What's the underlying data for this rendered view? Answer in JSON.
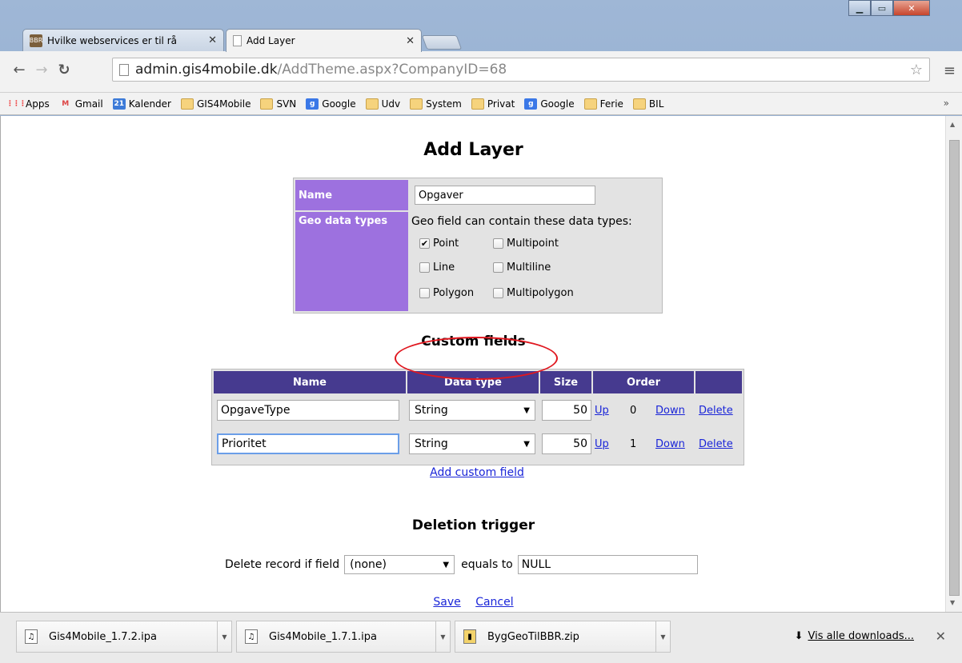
{
  "browser": {
    "tabs": [
      {
        "title": "Hvilke webservices er til rå",
        "favicon": "BBR"
      },
      {
        "title": "Add Layer"
      }
    ],
    "address": {
      "domain": "admin.gis4mobile.dk",
      "path": "/AddTheme.aspx?CompanyID=68"
    },
    "bookmarks": [
      {
        "label": "Apps",
        "icon": "apps-grid-icon"
      },
      {
        "label": "Gmail",
        "icon": "gmail-icon"
      },
      {
        "label": "Kalender",
        "icon": "calendar-icon",
        "icon_text": "21"
      },
      {
        "label": "GIS4Mobile",
        "icon": "folder-icon"
      },
      {
        "label": "SVN",
        "icon": "folder-icon"
      },
      {
        "label": "Google",
        "icon": "google-icon"
      },
      {
        "label": "Udv",
        "icon": "folder-icon"
      },
      {
        "label": "System",
        "icon": "folder-icon"
      },
      {
        "label": "Privat",
        "icon": "folder-icon"
      },
      {
        "label": "Google",
        "icon": "google-icon"
      },
      {
        "label": "Ferie",
        "icon": "folder-icon"
      },
      {
        "label": "BIL",
        "icon": "folder-icon"
      }
    ],
    "more_bookmarks": "»"
  },
  "page": {
    "title": "Add Layer",
    "name_label": "Name",
    "name_value": "Opgaver",
    "geo_label": "Geo data types",
    "geo_help": "Geo field can contain these data types:",
    "geo_types": [
      {
        "label": "Point",
        "checked": true
      },
      {
        "label": "Multipoint",
        "checked": false
      },
      {
        "label": "Line",
        "checked": false
      },
      {
        "label": "Multiline",
        "checked": false
      },
      {
        "label": "Polygon",
        "checked": false
      },
      {
        "label": "Multipolygon",
        "checked": false
      }
    ],
    "custom_fields_title": "Custom fields",
    "columns": [
      "Name",
      "Data type",
      "Size",
      "Order"
    ],
    "rows": [
      {
        "name": "OpgaveType",
        "type": "String",
        "size": "50",
        "up": "Up",
        "order": "0",
        "down": "Down",
        "delete": "Delete"
      },
      {
        "name": "Prioritet",
        "type": "String",
        "size": "50",
        "up": "Up",
        "order": "1",
        "down": "Down",
        "delete": "Delete"
      }
    ],
    "add_custom_field": "Add custom field",
    "deletion_title": "Deletion trigger",
    "delete_prefix": "Delete record if field",
    "delete_field": "(none)",
    "equals_to": "equals to",
    "equals_value": "NULL",
    "save": "Save",
    "cancel": "Cancel"
  },
  "downloads": {
    "items": [
      "Gis4Mobile_1.7.2.ipa",
      "Gis4Mobile_1.7.1.ipa",
      "BygGeoTilBBR.zip"
    ],
    "show_all": "Vis alle downloads..."
  },
  "colors": {
    "label_bg": "#9d71df",
    "header_bg": "#463a8f",
    "link": "#1a25d8",
    "annotation": "#e0171f"
  }
}
